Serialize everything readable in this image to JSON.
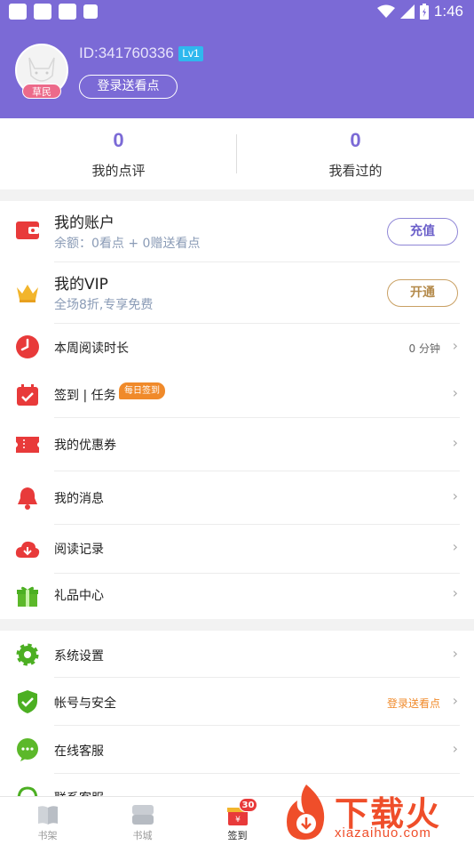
{
  "status_bar": {
    "time": "1:46"
  },
  "profile": {
    "avatar_badge": "草民",
    "user_id": "ID:341760336",
    "level": "Lv1",
    "login_button": "登录送看点"
  },
  "stats": [
    {
      "value": "0",
      "label": "我的点评"
    },
    {
      "value": "0",
      "label": "我看过的"
    }
  ],
  "account": {
    "title": "我的账户",
    "balance": "余额：0看点 + 0赠送看点",
    "recharge_button": "充值"
  },
  "vip": {
    "title": "我的VIP",
    "subtitle": "全场8折,专享免费",
    "open_button": "开通"
  },
  "menu": [
    {
      "label": "本周阅读时长",
      "right": "0 分钟",
      "icon": "clock-icon"
    },
    {
      "label": "签到 | 任务",
      "badge": "每日签到",
      "icon": "calendar-check-icon"
    },
    {
      "label": "我的优惠券",
      "icon": "coupon-icon"
    },
    {
      "label": "我的消息",
      "icon": "bell-icon"
    },
    {
      "label": "阅读记录",
      "icon": "cloud-download-icon"
    },
    {
      "label": "礼品中心",
      "icon": "gift-icon"
    }
  ],
  "settings": [
    {
      "label": "系统设置",
      "icon": "gear-icon"
    },
    {
      "label": "帐号与安全",
      "right": "登录送看点",
      "icon": "shield-icon"
    },
    {
      "label": "在线客服",
      "icon": "chat-icon"
    },
    {
      "label": "联系客服",
      "icon": "headset-icon"
    }
  ],
  "tabs": [
    {
      "label": "书架",
      "icon": "bookshelf-icon"
    },
    {
      "label": "书城",
      "icon": "store-icon"
    },
    {
      "label": "签到",
      "badge": "30",
      "icon": "checkin-gift-icon"
    }
  ],
  "watermark": {
    "brand": "下载火",
    "url": "xiazaihuo.com"
  },
  "colors": {
    "primary": "#7b6ad6",
    "vip_gold": "#c9a063",
    "red": "#e83a3a",
    "green": "#4caf22",
    "orange": "#f08a2a"
  }
}
